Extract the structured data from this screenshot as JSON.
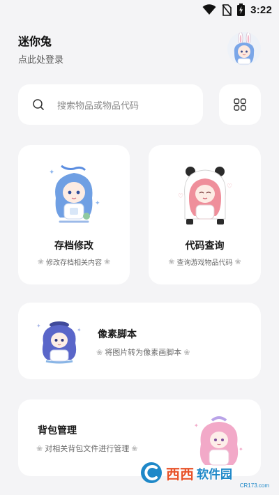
{
  "status_bar": {
    "time": "3:22",
    "icons": [
      "wifi-icon",
      "no-sim-icon",
      "battery-charging-icon"
    ]
  },
  "header": {
    "app_name": "迷你兔",
    "login_hint": "点此处登录",
    "avatar_icon": "bunny-girl-avatar"
  },
  "search": {
    "placeholder": "搜索物品或物品代码",
    "icon": "search-icon"
  },
  "grid_button": {
    "icon": "grid-icon"
  },
  "cards": {
    "save_edit": {
      "title": "存档修改",
      "subtitle": "修改存档相关内容"
    },
    "code_lookup": {
      "title": "代码查询",
      "subtitle": "查询游戏物品代码"
    },
    "pixel_script": {
      "title": "像素脚本",
      "subtitle": "将图片转为像素画脚本"
    },
    "bag_manage": {
      "title": "背包管理",
      "subtitle": "对相关背包文件进行管理"
    }
  },
  "watermark": {
    "brand_a": "西西",
    "brand_b": "软件园",
    "url": "CR173.com"
  },
  "colors": {
    "background": "#f4f4f6",
    "card": "#ffffff",
    "blue_hair": "#6f9fe3",
    "pink_hair": "#ef8f9b",
    "purple_hair": "#5a66c9",
    "lilac_hair": "#f2a9c8"
  }
}
